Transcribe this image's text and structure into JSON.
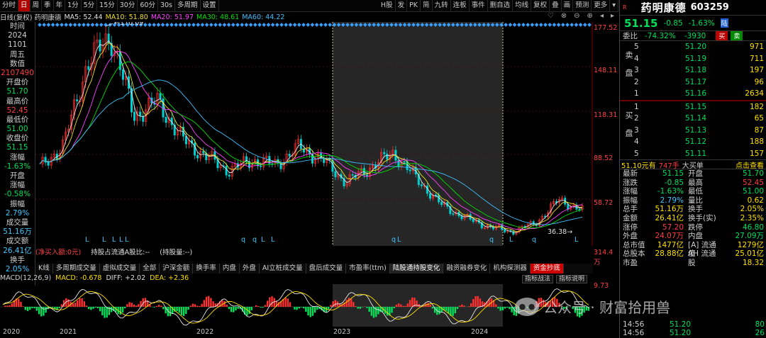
{
  "toolbar": {
    "left_items": [
      "分时",
      "日",
      "周",
      "季",
      "年",
      "1分",
      "5分",
      "15分",
      "30分",
      "60分",
      "30s",
      "多周期",
      "设置"
    ],
    "active_item": "日",
    "right_items": [
      "H股",
      "发",
      "PK",
      "简",
      "九转",
      "连板",
      "事件",
      "删自选",
      "均线",
      "复权",
      "叠",
      "画",
      "预测",
      "更多"
    ]
  },
  "ma_line": {
    "title": "日线(复权) 药明康德",
    "ma5": "MA5: 52.44",
    "ma10": "MA10: 51.80",
    "ma20": "MA20: 51.97",
    "ma30": "MA30: 48.61",
    "ma60": "MA60: 44.22"
  },
  "left_panel": [
    {
      "text": "时间",
      "cls": "lbl"
    },
    {
      "text": "2024",
      "cls": "lbl"
    },
    {
      "text": "1101",
      "cls": "lbl"
    },
    {
      "text": "周五",
      "cls": "lbl"
    },
    {
      "text": "数值",
      "cls": "lbl"
    },
    {
      "text": "2107490",
      "cls": "red"
    },
    {
      "text": "开盘价",
      "cls": "lbl"
    },
    {
      "text": "51.70",
      "cls": "green"
    },
    {
      "text": "最高价",
      "cls": "lbl"
    },
    {
      "text": "52.45",
      "cls": "red"
    },
    {
      "text": "最低价",
      "cls": "lbl"
    },
    {
      "text": "51.00",
      "cls": "green"
    },
    {
      "text": "收盘价",
      "cls": "lbl"
    },
    {
      "text": "51.15",
      "cls": "green"
    },
    {
      "text": "涨幅",
      "cls": "lbl"
    },
    {
      "text": "-1.63%",
      "cls": "green"
    },
    {
      "text": "开盘",
      "cls": "lbl"
    },
    {
      "text": "涨幅",
      "cls": "lbl"
    },
    {
      "text": "-0.58%",
      "cls": "green"
    },
    {
      "text": "振幅",
      "cls": "lbl"
    },
    {
      "text": "2.79%",
      "cls": "cyan"
    },
    {
      "text": "成交量",
      "cls": "lbl"
    },
    {
      "text": "51.16万",
      "cls": "cyan"
    },
    {
      "text": "成交额",
      "cls": "lbl"
    },
    {
      "text": "26.41亿",
      "cls": "cyan"
    },
    {
      "text": "换手",
      "cls": "lbl"
    },
    {
      "text": "2.05%",
      "cls": "cyan"
    }
  ],
  "chart": {
    "right_axis_labels": [
      "177.52",
      "148.11",
      "118.31",
      "88.52",
      "58.72"
    ],
    "high_marker": "170.09",
    "low_marker": "36.38",
    "macd_top_label": "9.73",
    "vol_label": "314.4万",
    "event_glyphs": [
      "L",
      "L",
      "L",
      "L",
      "L",
      "q",
      "q",
      "L",
      "L",
      "q",
      "L",
      "q",
      "L",
      "q",
      "L"
    ]
  },
  "chart_data": {
    "type": "line",
    "title": "日线(复权) 药明康德",
    "ylim": [
      36.38,
      177.52
    ],
    "x": [
      "2020",
      "2021",
      "2022",
      "2023",
      "2024"
    ],
    "series": [
      {
        "name": "close",
        "values": [
          80,
          95,
          150,
          170.09,
          115,
          125,
          100,
          88,
          78,
          85,
          82,
          94,
          85,
          70,
          80,
          90,
          72,
          55,
          46,
          40,
          36.38,
          42,
          58,
          51.15
        ]
      }
    ]
  },
  "holding_bar": {
    "a": "(净买入额:0元)",
    "b": "持股占流通A股比:--",
    "c": "(持股量:--)"
  },
  "tabs": [
    "K线",
    "多周期成交量",
    "虚拟成交量",
    "全部",
    "沪深金额",
    "换手率",
    "内盘",
    "外盘",
    "AI立桩成交量",
    "盘后成交量",
    "市盈率(ttm)",
    "陆股通持股变化",
    "融资融券变化",
    "机构探测器",
    "资金抄底"
  ],
  "tab_selected": "陆股通持股变化",
  "macd": {
    "title": "MACD(12,26,9)",
    "macd": "MACD: -0.678",
    "dif": "DIFF: +2.02",
    "dea": "DEA: +2.36",
    "btn1": "指标战法",
    "btn2": "指标说明"
  },
  "years": [
    "2020",
    "2021",
    "2022",
    "2023",
    "2024"
  ],
  "quote": {
    "r_mark": "R",
    "name": "药明康德",
    "code": "603259",
    "price": "51.15",
    "change": "-0.85",
    "change_pct": "-1.63%",
    "land": "陆",
    "wb_label": "委比",
    "wb_pct": "-74.32%",
    "wb_diff": "-3930",
    "buy_btn": "买",
    "sell_btn": "卖",
    "sell_label": "卖盘",
    "buy_label": "买盘",
    "asks": [
      {
        "lv": "5",
        "pr": "51.20",
        "vol": "971"
      },
      {
        "lv": "4",
        "pr": "51.19",
        "vol": "711"
      },
      {
        "lv": "3",
        "pr": "51.18",
        "vol": "197"
      },
      {
        "lv": "2",
        "pr": "51.17",
        "vol": "96"
      },
      {
        "lv": "1",
        "pr": "51.16",
        "vol": "2634"
      }
    ],
    "bids": [
      {
        "lv": "1",
        "pr": "51.15",
        "vol": "182"
      },
      {
        "lv": "2",
        "pr": "51.14",
        "vol": "65"
      },
      {
        "lv": "3",
        "pr": "51.13",
        "vol": "87"
      },
      {
        "lv": "4",
        "pr": "51.12",
        "vol": "188"
      },
      {
        "lv": "5",
        "pr": "51.11",
        "vol": "157"
      }
    ],
    "trade_bar": {
      "a": "51.10元有",
      "b": "747手",
      "c": "大买单",
      "d": "点击查看"
    },
    "stats": [
      {
        "k1": "最新",
        "v1": "51.15",
        "c1": "green",
        "k2": "开盘",
        "v2": "51.70",
        "c2": "green"
      },
      {
        "k1": "涨跌",
        "v1": "-0.85",
        "c1": "green",
        "k2": "最高",
        "v2": "52.45",
        "c2": "red"
      },
      {
        "k1": "涨幅",
        "v1": "-1.63%",
        "c1": "green",
        "k2": "最低",
        "v2": "51.00",
        "c2": "green"
      },
      {
        "k1": "振幅",
        "v1": "2.79%",
        "c1": "cyan",
        "k2": "量比",
        "v2": "0.62",
        "c2": "yellow"
      },
      {
        "k1": "总手",
        "v1": "51.16万",
        "c1": "yellow",
        "k2": "换手",
        "v2": "2.05%",
        "c2": "yellow"
      },
      {
        "k1": "金额",
        "v1": "26.41亿",
        "c1": "yellow",
        "k2": "换手(实)",
        "v2": "2.35%",
        "c2": "yellow"
      },
      {
        "k1": "涨停",
        "v1": "57.20",
        "c1": "red",
        "k2": "跌停",
        "v2": "46.80",
        "c2": "green"
      },
      {
        "k1": "外盘",
        "v1": "24.07万",
        "c1": "red",
        "k2": "内盘",
        "v2": "27.09万",
        "c2": "green"
      },
      {
        "k1": "总市值",
        "v1": "1477亿",
        "c1": "yellow",
        "k2": "[A] 流通值",
        "v2": "1279亿",
        "c2": "yellow"
      },
      {
        "k1": "总股本",
        "v1": "28.88亿",
        "c1": "yellow",
        "k2": "AH 流通股",
        "v2": "25.01亿",
        "c2": "yellow"
      },
      {
        "k1": "市盈",
        "v1": "",
        "c1": "yellow",
        "k2": "",
        "v2": "18.32",
        "c2": "yellow"
      }
    ],
    "ticks": [
      {
        "t": "14:56",
        "p": "51.20",
        "v": "80",
        "vc": "green"
      },
      {
        "t": "14:56",
        "p": "51.20",
        "v": "26",
        "vc": "green"
      }
    ]
  },
  "watermark": "公众号 · 财富拾用兽"
}
